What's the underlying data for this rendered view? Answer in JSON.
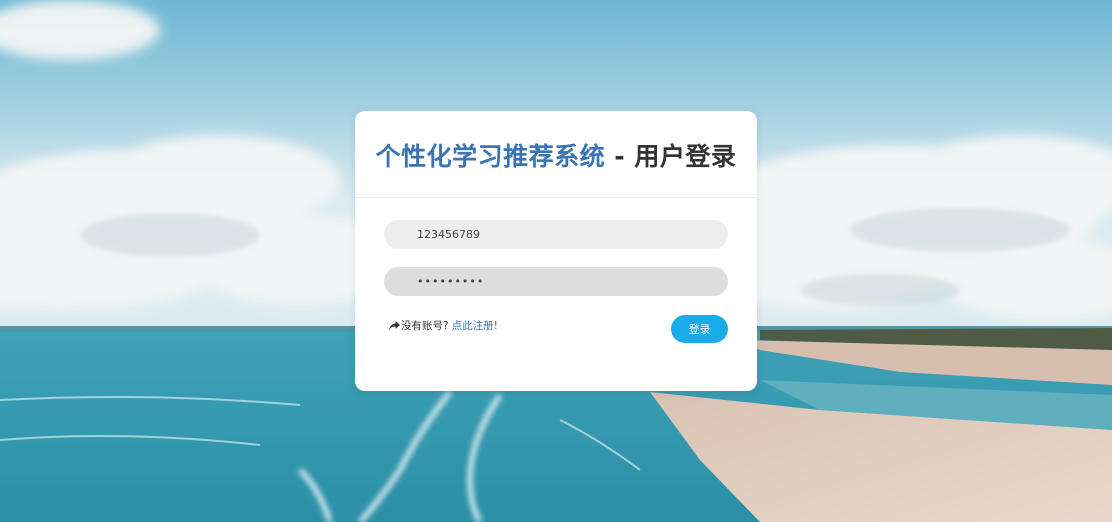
{
  "login": {
    "title_brand": "个性化学习推荐系统",
    "title_separator": " - ",
    "title_page": "用户登录",
    "username_value": "123456789",
    "password_value": "•••••••••",
    "register_prompt": "没有账号?",
    "register_link": "点此注册!",
    "login_button": "登录"
  },
  "icons": {
    "register": "share-arrow-icon"
  },
  "colors": {
    "brand": "#3a74b4",
    "button": "#1aabe9"
  }
}
